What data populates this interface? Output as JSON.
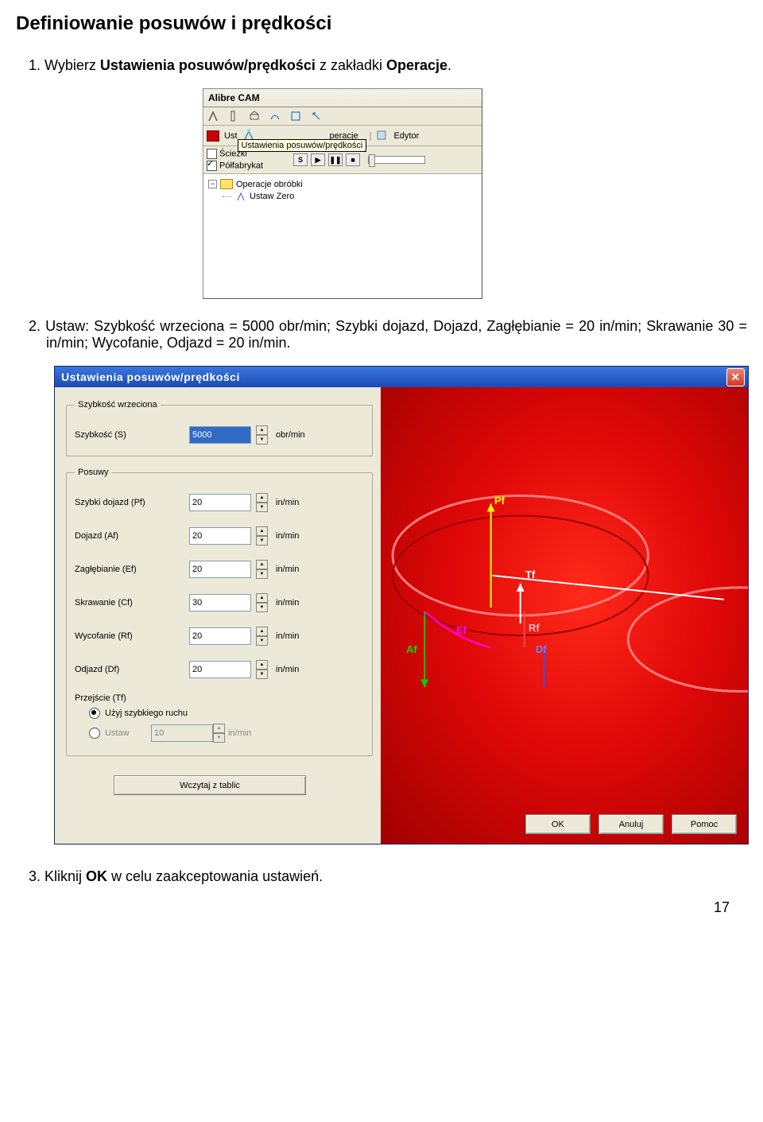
{
  "heading": "Definiowanie posuwów i prędkości",
  "step1_prefix": "1.  Wybierz ",
  "step1_bold1": "Ustawienia posuwów/prędkości",
  "step1_mid": " z zakładki ",
  "step1_bold2": "Operacje",
  "step1_suffix": ".",
  "step2": "2.  Ustaw: Szybkość wrzeciona = 5000 obr/min; Szybki dojazd, Dojazd, Zagłębianie = 20 in/min; Skrawanie 30 =  in/min; Wycofanie, Odjazd = 20 in/min.",
  "step3_prefix": "3.  Kliknij ",
  "step3_bold": "OK",
  "step3_suffix": " w celu zaakceptowania ustawień.",
  "page_number": "17",
  "panel": {
    "title": "Alibre CAM",
    "toolbar2": {
      "ust_prefix": "Ust",
      "tooltip": "Ustawienia posuwów/prędkości",
      "peracje": "peracje",
      "edytor": "Edytor"
    },
    "checks": {
      "sciezki": "Ścieżki",
      "polfab": "Półfabrykat",
      "s_btn": "S"
    },
    "tree": {
      "root": "Operacje obróbki",
      "child": "Ustaw Zero"
    }
  },
  "dialog": {
    "title": "Ustawienia posuwów/prędkości",
    "grp_speed": {
      "legend": "Szybkość wrzeciona",
      "label": "Szybkość (S)",
      "value": "5000",
      "unit": "obr/min"
    },
    "grp_feeds": {
      "legend": "Posuwy",
      "rows": [
        {
          "label": "Szybki dojazd (Pf)",
          "value": "20",
          "unit": "in/min"
        },
        {
          "label": "Dojazd (Af)",
          "value": "20",
          "unit": "in/min"
        },
        {
          "label": "Zagłębianie (Ef)",
          "value": "20",
          "unit": "in/min"
        },
        {
          "label": "Skrawanie (Cf)",
          "value": "30",
          "unit": "in/min"
        },
        {
          "label": "Wycofanie (Rf)",
          "value": "20",
          "unit": "in/min"
        },
        {
          "label": "Odjazd (Df)",
          "value": "20",
          "unit": "in/min"
        }
      ],
      "transition_label": "Przejście (Tf)",
      "radio_fast": "Użyj szybkiego ruchu",
      "radio_set": "Ustaw",
      "set_value": "10",
      "set_unit": "in/min"
    },
    "btn_load": "Wczytaj z tablic",
    "btn_ok": "OK",
    "btn_cancel": "Anuluj",
    "btn_help": "Pomoc",
    "diagram_labels": {
      "pf": "Pf",
      "tf": "Tf",
      "ef": "Ef",
      "af": "Af",
      "rf": "Rf",
      "df": "Df"
    }
  }
}
